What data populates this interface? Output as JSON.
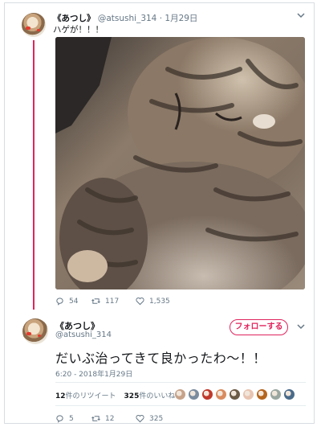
{
  "tweet1": {
    "name": "《あつし》",
    "handle": "@atsushi_314",
    "separator": "·",
    "date": "1月29日",
    "text": "ハゲが！！！",
    "actions": {
      "replies": "54",
      "retweets": "117",
      "likes": "1,535"
    }
  },
  "tweet2": {
    "name": "《あつし》",
    "handle": "@atsushi_314",
    "follow_label": "フォローする",
    "text": "だいぶ治ってきて良かったわ〜！！",
    "timestamp": "6:20 - 2018年1月29日",
    "stats": {
      "retweets_count": "12",
      "retweets_label": "件のリツイート",
      "likes_count": "325",
      "likes_label": "件のいいね"
    },
    "liker_colors": [
      "#c7a38a",
      "#7a8c9e",
      "#c0392b",
      "#d98c5f",
      "#6b5b45",
      "#e8c4b0",
      "#b5651d",
      "#9aa7a0",
      "#4a6b8a"
    ],
    "actions": {
      "replies": "5",
      "retweets": "12",
      "likes": "325"
    }
  },
  "colors": {
    "accent": "#e0245e",
    "muted": "#657786",
    "text": "#14171a"
  },
  "icons": [
    "reply-icon",
    "retweet-icon",
    "heart-icon",
    "chevron-down-icon"
  ]
}
